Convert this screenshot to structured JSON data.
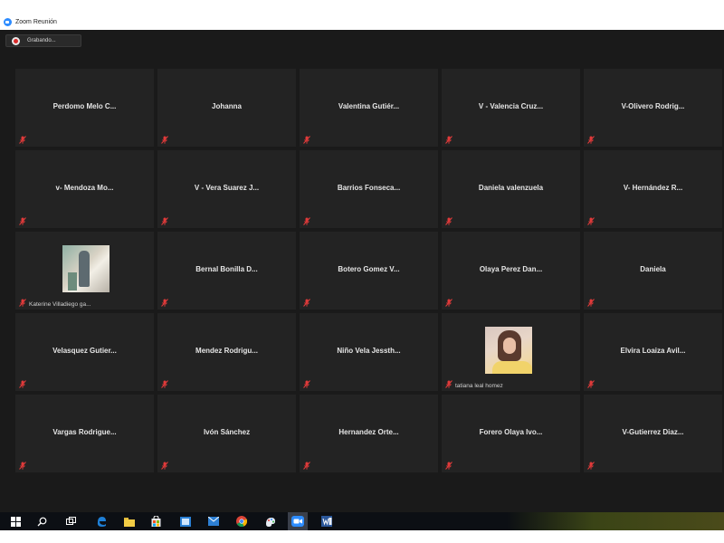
{
  "window": {
    "title": "Zoom Reunión"
  },
  "recording": {
    "label": "Grabando..."
  },
  "participants": [
    {
      "name": "Perdomo Melo C..."
    },
    {
      "name": "Johanna"
    },
    {
      "name": "Valentina Gutiér..."
    },
    {
      "name": "V - Valencia Cruz..."
    },
    {
      "name": "V-Olivero Rodrig..."
    },
    {
      "name": "v- Mendoza Mo..."
    },
    {
      "name": "V - Vera Suarez J..."
    },
    {
      "name": "Barrios Fonseca..."
    },
    {
      "name": "Daniela valenzuela"
    },
    {
      "name": "V- Hernández R..."
    },
    {
      "name": "Katerine Villadiego ga...",
      "video": true
    },
    {
      "name": "Bernal Bonilla D..."
    },
    {
      "name": "Botero Gomez V..."
    },
    {
      "name": "Olaya Perez Dan..."
    },
    {
      "name": "Daniela"
    },
    {
      "name": "Velasquez Gutier..."
    },
    {
      "name": "Mendez Rodrigu..."
    },
    {
      "name": "Niño Vela Jessth..."
    },
    {
      "name": "tatiana leal homez",
      "video": true
    },
    {
      "name": "Elvira Loaiza Avil..."
    },
    {
      "name": "Vargas Rodrigue..."
    },
    {
      "name": "Ivón Sánchez"
    },
    {
      "name": "Hernandez Orte..."
    },
    {
      "name": "Forero Olaya Ivo..."
    },
    {
      "name": "V-Gutierrez Diaz..."
    }
  ],
  "taskbar": {
    "items": [
      {
        "icon": "windows-start-icon"
      },
      {
        "icon": "search-icon"
      },
      {
        "icon": "task-view-icon"
      },
      {
        "icon": "edge-icon"
      },
      {
        "icon": "file-explorer-icon"
      },
      {
        "icon": "store-icon"
      },
      {
        "icon": "photos-icon"
      },
      {
        "icon": "mail-icon"
      },
      {
        "icon": "chrome-icon"
      },
      {
        "icon": "paint-icon"
      },
      {
        "icon": "zoom-icon",
        "active": true
      },
      {
        "icon": "word-icon"
      }
    ]
  },
  "colors": {
    "mute": "#e03a3a",
    "tile_bg": "#232323",
    "meeting_bg": "#1a1a1a",
    "zoom_blue": "#2d8cff"
  }
}
